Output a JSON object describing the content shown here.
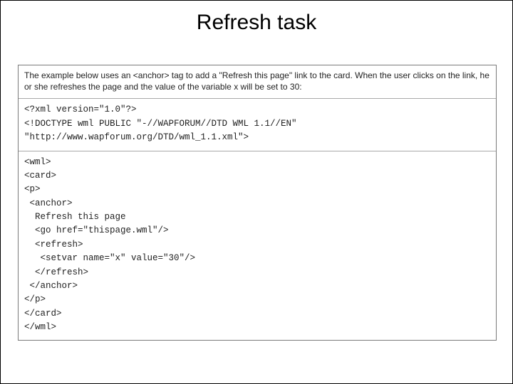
{
  "title": "Refresh task",
  "description": "The example below uses an <anchor> tag to add a \"Refresh this page\" link to the card. When the user clicks on the link, he or she refreshes the page and the value of the variable x will be set to 30:",
  "code1": "<?xml version=\"1.0\"?>\n<!DOCTYPE wml PUBLIC \"-//WAPFORUM//DTD WML 1.1//EN\"\n\"http://www.wapforum.org/DTD/wml_1.1.xml\">",
  "code2": "<wml>\n<card>\n<p>\n <anchor>\n  Refresh this page\n  <go href=\"thispage.wml\"/>\n  <refresh>\n   <setvar name=\"x\" value=\"30\"/>\n  </refresh>\n </anchor>\n</p>\n</card>\n</wml>"
}
